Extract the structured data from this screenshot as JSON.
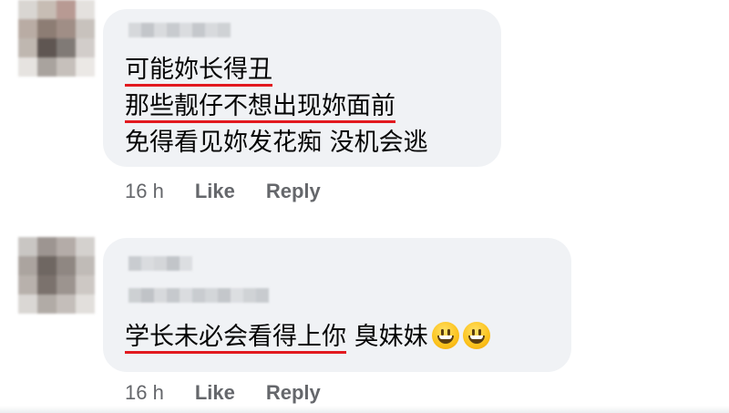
{
  "comments": [
    {
      "lines": [
        {
          "text": "可能妳长得丑",
          "underlined": true
        },
        {
          "text": "那些靓仔不想出现妳面前",
          "underlined": true
        },
        {
          "text": "免得看见妳发花痴 没机会逃",
          "underlined": false
        }
      ],
      "time": "16 h",
      "like_label": "Like",
      "reply_label": "Reply"
    },
    {
      "underlined_text": "学长未必会看得上你",
      "rest_text": " 臭妹妹",
      "emojis": [
        "grinning-face",
        "grinning-face"
      ],
      "time": "16 h",
      "like_label": "Like",
      "reply_label": "Reply"
    }
  ],
  "colors": {
    "bubble": "#f0f2f5",
    "underline": "#e2191f",
    "meta_text": "#65676b",
    "text": "#050505"
  }
}
